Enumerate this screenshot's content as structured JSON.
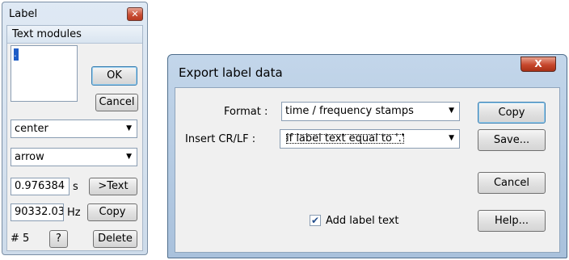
{
  "label_window": {
    "title": "Label",
    "close_glyph": "✕",
    "header": "Text modules",
    "text_value": ".",
    "ok_label": "OK",
    "cancel_label": "Cancel",
    "align_select": "center",
    "style_select": "arrow",
    "time_value": "0.976384",
    "time_unit": "s",
    "to_text_label": ">Text",
    "freq_value": "90332.03",
    "freq_unit": "Hz",
    "copy_label": "Copy",
    "number_label": "# 5",
    "help_label": "?",
    "delete_label": "Delete"
  },
  "export_dialog": {
    "title": "Export label data",
    "close_glyph": "X",
    "format_label": "Format :",
    "format_value": "time / frequency stamps",
    "crlf_label": "Insert CR/LF :",
    "crlf_value": "if label text equal to '.'",
    "add_label_text": "Add label text",
    "add_label_checked": true,
    "copy_label": "Copy",
    "save_label": "Save...",
    "cancel_label": "Cancel",
    "help_label": "Help..."
  },
  "icons": {
    "dropdown_arrow": "▼",
    "check_mark": "✔"
  }
}
